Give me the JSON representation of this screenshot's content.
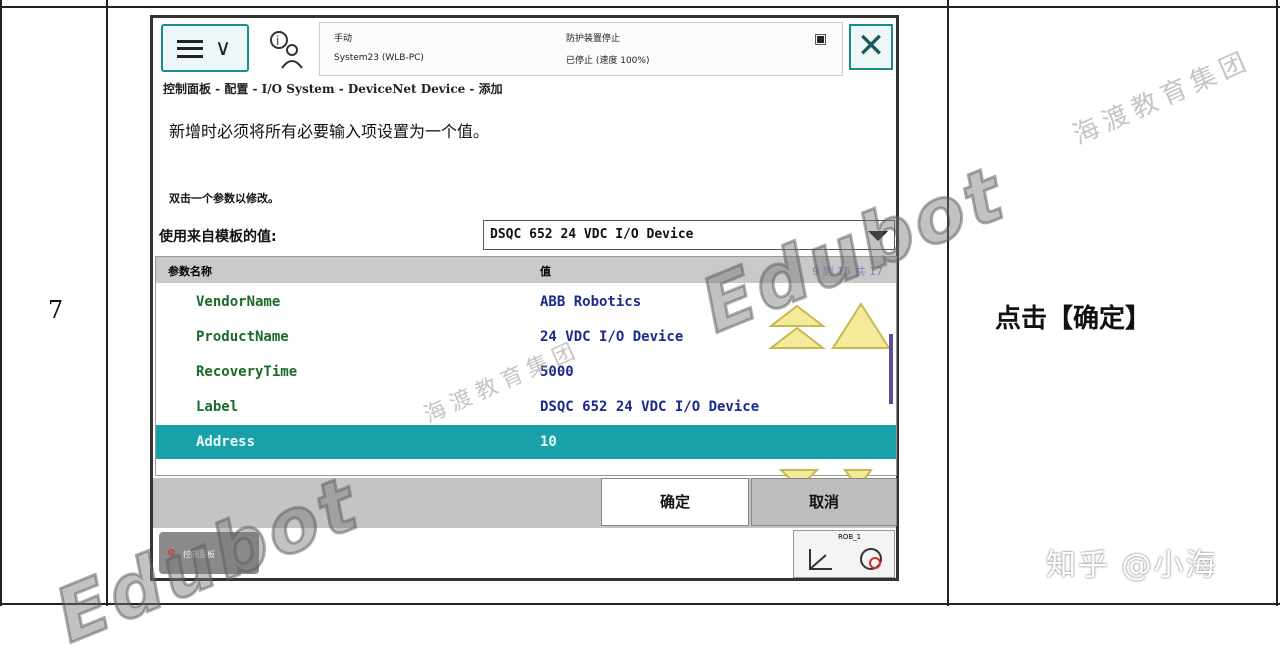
{
  "step_number": "7",
  "instruction": "点击【确定】",
  "credit": "知乎 @小海",
  "watermarks": {
    "brand_cn": "海渡教育集团",
    "brand_logo": "Edubot"
  },
  "pendant": {
    "status": {
      "mode": "手动",
      "system": "System23 (WLB-PC)",
      "state": "防护装置停止",
      "speed": "已停止 (速度 100%)"
    },
    "breadcrumb": "控制面板 - 配置 - I/O System - DeviceNet Device - 添加",
    "message": "新增时必须将所有必要输入项设置为一个值。",
    "hint": "双击一个参数以修改。",
    "template_label": "使用来自模板的值:",
    "template_value": "DSQC 652 24 VDC I/O Device",
    "grid": {
      "col_name": "参数名称",
      "col_value": "值",
      "range": "9 到 15 共 17",
      "rows": [
        {
          "name": "VendorName",
          "value": "ABB Robotics"
        },
        {
          "name": "ProductName",
          "value": "24 VDC I/O Device"
        },
        {
          "name": "RecoveryTime",
          "value": "5000"
        },
        {
          "name": "Label",
          "value": "DSQC 652 24 VDC I/O Device"
        },
        {
          "name": "Address",
          "value": "10"
        }
      ]
    },
    "ok_label": "确定",
    "cancel_label": "取消",
    "taskbar_tab": "控制面板",
    "quickset_label": "ROB_1"
  },
  "colors": {
    "teal_accent": "#1aa0a8",
    "param_name": "#1a6a2a",
    "param_value": "#1a2a8a"
  }
}
